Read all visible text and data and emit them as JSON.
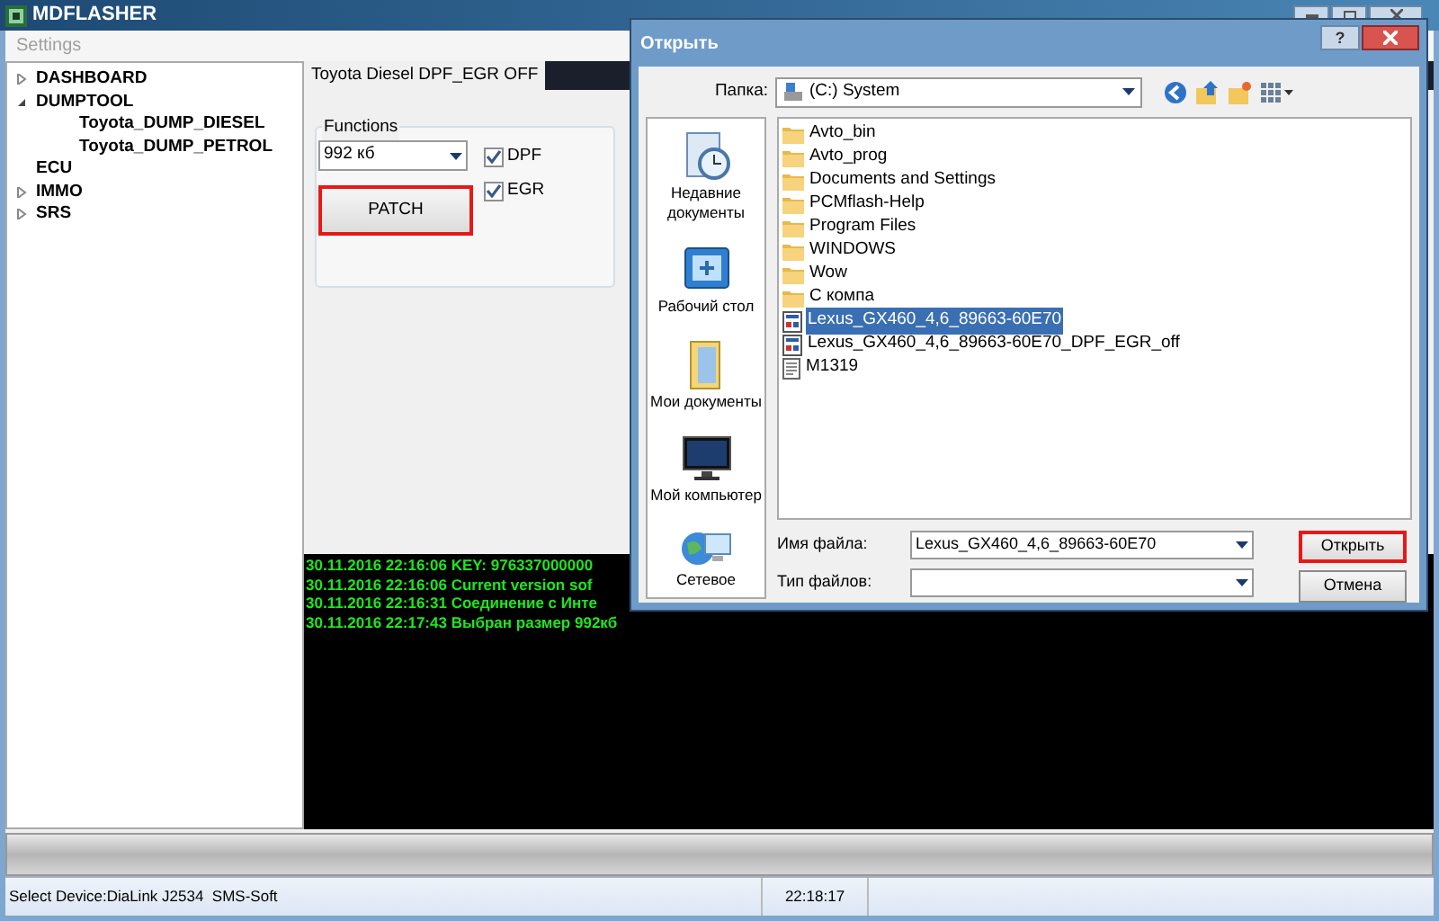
{
  "window": {
    "title": "MDFLASHER"
  },
  "menu": [
    {
      "label": "Settings",
      "disabled": true
    }
  ],
  "tree": [
    {
      "label": "DASHBOARD",
      "expanded": false
    },
    {
      "label": "DUMPTOOL",
      "expanded": true,
      "children": [
        {
          "label": "Toyota_DUMP_DIESEL"
        },
        {
          "label": "Toyota_DUMP_PETROL"
        }
      ]
    },
    {
      "label": "ECU"
    },
    {
      "label": "IMMO",
      "expanded": false
    },
    {
      "label": "SRS",
      "expanded": false
    }
  ],
  "tabs": [
    {
      "label": "Toyota Diesel DPF_EGR OFF",
      "selected": true
    }
  ],
  "functions": {
    "title": "Functions",
    "size_select": "992 кб",
    "checks": [
      {
        "label": "DPF",
        "checked": true
      },
      {
        "label": "EGR",
        "checked": true
      }
    ],
    "patch_button": {
      "label": "PATCH",
      "focused": true
    }
  },
  "log": [
    {
      "time": "30.11.2016 22:16:06",
      "text": "KEY: 976337000000"
    },
    {
      "time": "30.11.2016 22:16:06",
      "text": "Current version sof"
    },
    {
      "time": "30.11.2016 22:16:31",
      "text": "Соединение с Инте"
    },
    {
      "time": "30.11.2016 22:17:43",
      "text": "Выбран размер 992кб"
    }
  ],
  "progress": {
    "level": 0
  },
  "status_bar": {
    "device": "Select Device:DiaLink J2534  SMS-Soft",
    "time": "22:18:17"
  },
  "dialog": {
    "title": "Открыть",
    "help": "?",
    "folder_label": "Папка:",
    "folder": "(C:) System",
    "places": [
      {
        "kind": "recent",
        "label": "Недавние документы"
      },
      {
        "kind": "desktop",
        "label": "Рабочий стол"
      },
      {
        "kind": "documents",
        "label": "Мои документы"
      },
      {
        "kind": "computer",
        "label": "Мой компьютер"
      },
      {
        "kind": "network",
        "label": "Сетевое"
      }
    ],
    "files": [
      {
        "kind": "folder",
        "name": "Avto_bin",
        "selected": false
      },
      {
        "kind": "folder",
        "name": "Avto_prog",
        "selected": false
      },
      {
        "kind": "folder",
        "name": "Documents and Settings",
        "selected": false
      },
      {
        "kind": "folder",
        "name": "PCMflash-Help",
        "selected": false
      },
      {
        "kind": "folder",
        "name": "Program Files",
        "selected": false
      },
      {
        "kind": "folder",
        "name": "WINDOWS",
        "selected": false
      },
      {
        "kind": "folder",
        "name": "Wow",
        "selected": false
      },
      {
        "kind": "folder",
        "name": "С компа",
        "selected": false
      },
      {
        "kind": "program",
        "name": "Lexus_GX460_4,6_89663-60E70",
        "selected": true
      },
      {
        "kind": "program",
        "name": "Lexus_GX460_4,6_89663-60E70_DPF_EGR_off",
        "selected": false
      },
      {
        "kind": "document",
        "name": "M1319",
        "selected": false
      }
    ],
    "filename_label": "Имя файла:",
    "filename": "Lexus_GX460_4,6_89663-60E70",
    "filetype_label": "Тип файлов:",
    "buttons": [
      {
        "label": "Открыть",
        "focused": true
      },
      {
        "label": "Отмена",
        "focused": false
      }
    ]
  }
}
